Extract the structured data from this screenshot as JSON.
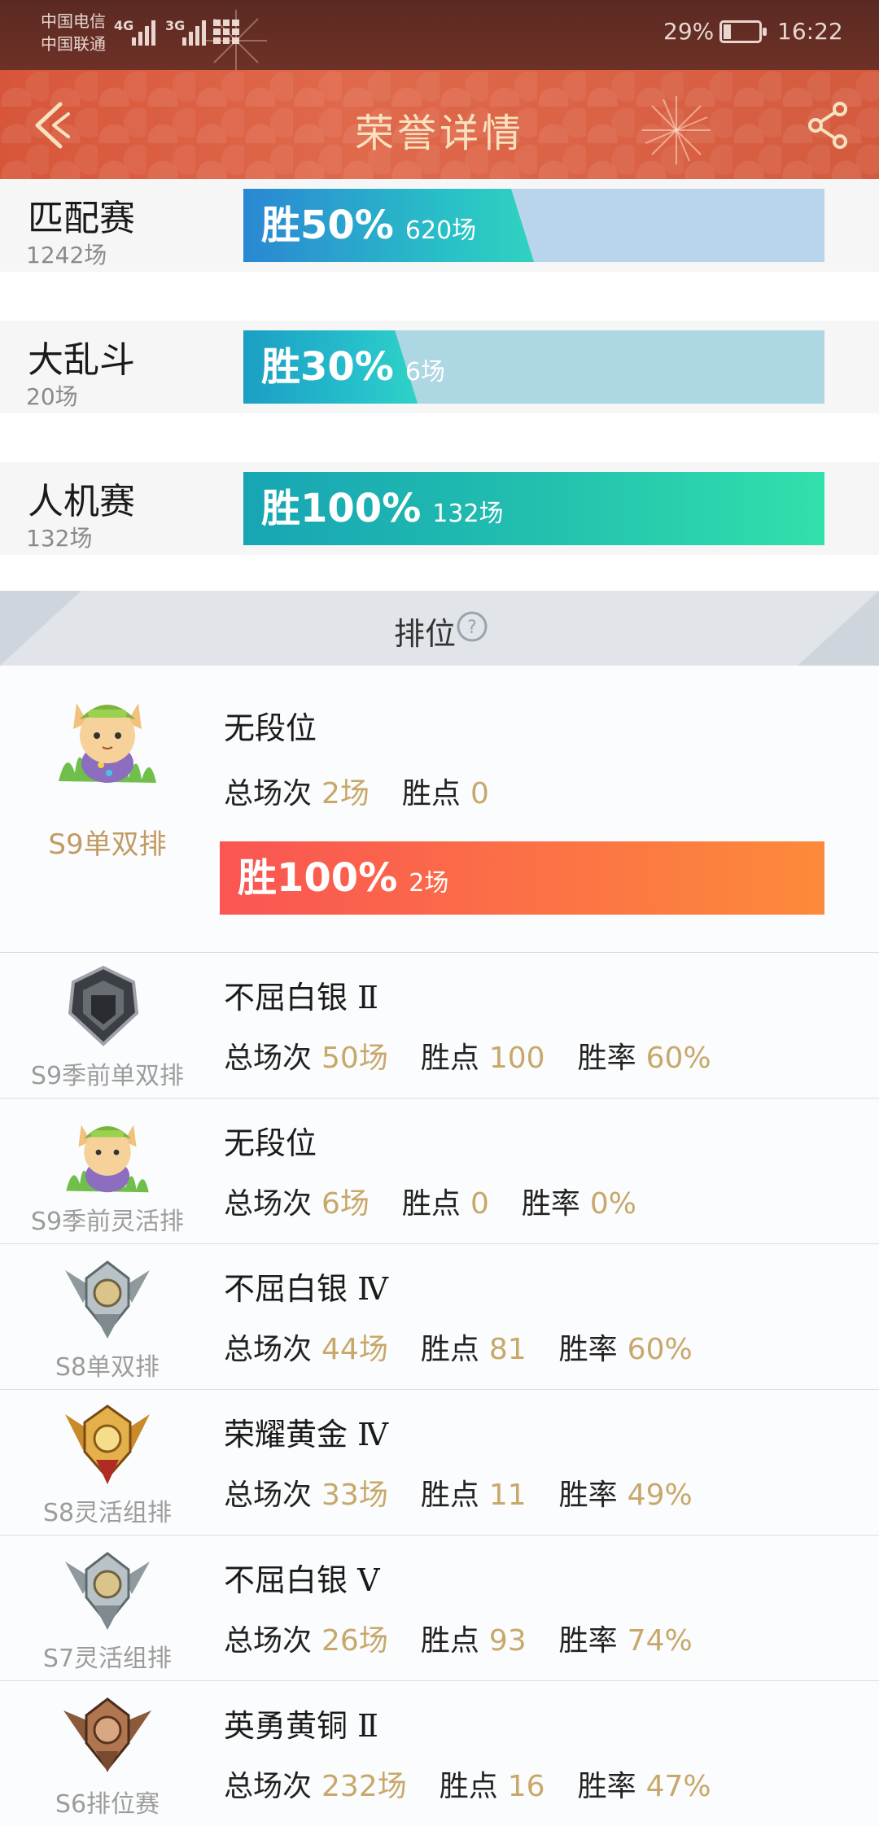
{
  "status_bar": {
    "carrier1": "中国电信",
    "carrier2": "中国联通",
    "net1": "4G",
    "net2": "3G",
    "battery_pct": "29%",
    "battery_level": 0.29,
    "time": "16:22"
  },
  "header": {
    "title": "荣誉详情",
    "back_icon": "back-chevron-icon",
    "share_icon": "share-icon"
  },
  "modes": [
    {
      "name": "匹配赛",
      "total": "1242场",
      "win_label": "胜50%",
      "win_games": "620场",
      "win_rate": 0.5
    },
    {
      "name": "大乱斗",
      "total": "20场",
      "win_label": "胜30%",
      "win_games": "6场",
      "win_rate": 0.3
    },
    {
      "name": "人机赛",
      "total": "132场",
      "win_label": "胜100%",
      "win_games": "132场",
      "win_rate": 1.0
    }
  ],
  "ranked": {
    "title": "排位",
    "help_icon": "help-circle-icon",
    "current": {
      "season": "S9单双排",
      "rank": "无段位",
      "games_label": "总场次",
      "games": "2场",
      "lp_label": "胜点",
      "lp": "0",
      "win_label": "胜100%",
      "win_games": "2场"
    },
    "win_rate_label": "胜率",
    "history": [
      {
        "season": "S9季前单双排",
        "rank": "不屈白银 Ⅱ",
        "games": "50场",
        "lp": "100",
        "winrate": "60%",
        "emblem": "iron-emblem-icon"
      },
      {
        "season": "S9季前灵活排",
        "rank": "无段位",
        "games": "6场",
        "lp": "0",
        "winrate": "0%",
        "emblem": "teemo-avatar-icon"
      },
      {
        "season": "S8单双排",
        "rank": "不屈白银 Ⅳ",
        "games": "44场",
        "lp": "81",
        "winrate": "60%",
        "emblem": "silver-emblem-icon"
      },
      {
        "season": "S8灵活组排",
        "rank": "荣耀黄金 Ⅳ",
        "games": "33场",
        "lp": "11",
        "winrate": "49%",
        "emblem": "gold-emblem-icon"
      },
      {
        "season": "S7灵活组排",
        "rank": "不屈白银 Ⅴ",
        "games": "26场",
        "lp": "93",
        "winrate": "74%",
        "emblem": "silver-emblem-icon"
      },
      {
        "season": "S6排位赛",
        "rank": "英勇黄铜 Ⅱ",
        "games": "232场",
        "lp": "16",
        "winrate": "47%",
        "emblem": "bronze-emblem-icon"
      }
    ]
  }
}
